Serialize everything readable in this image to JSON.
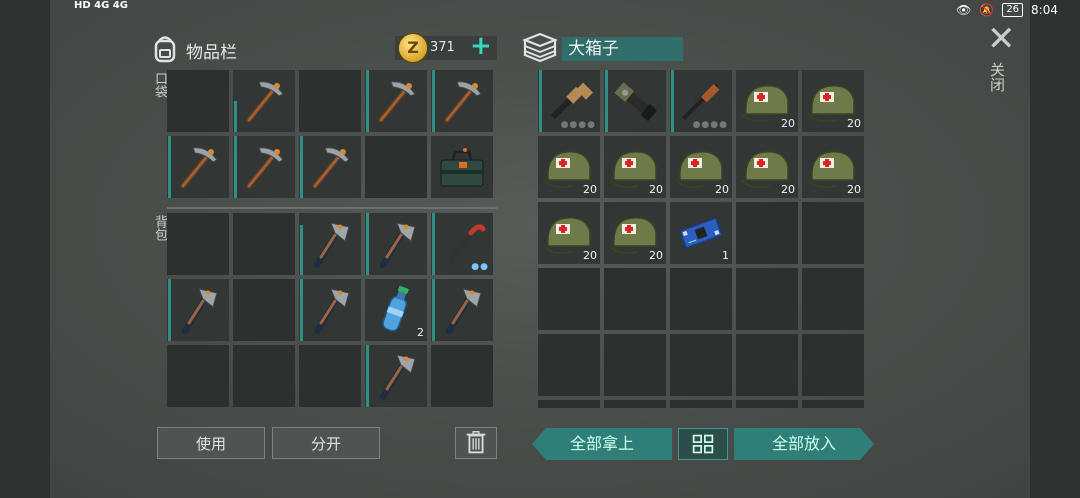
{
  "status": {
    "network_left": "HD 4G 4G",
    "battery": "26",
    "time": "8:04"
  },
  "inventory": {
    "title": "物品栏",
    "coins": "371",
    "pocket_label": "口袋",
    "backpack_label": "背包",
    "pocket_slots": [
      {
        "item": "",
        "bar": 0
      },
      {
        "item": "pickaxe",
        "bar": 0.5
      },
      {
        "item": "",
        "bar": 0
      },
      {
        "item": "pickaxe",
        "bar": 1
      },
      {
        "item": "pickaxe",
        "bar": 1
      },
      {
        "item": "pickaxe",
        "bar": 1
      },
      {
        "item": "pickaxe",
        "bar": 1
      },
      {
        "item": "pickaxe",
        "bar": 1
      },
      {
        "item": "",
        "bar": 0
      },
      {
        "item": "toolbox",
        "bar": 0
      }
    ],
    "backpack_slots": [
      {
        "item": "",
        "bar": 0
      },
      {
        "item": "",
        "bar": 0
      },
      {
        "item": "axe",
        "bar": 0.8
      },
      {
        "item": "axe",
        "bar": 1
      },
      {
        "item": "crowbar",
        "bar": 1,
        "dots": true
      },
      {
        "item": "axe",
        "bar": 1
      },
      {
        "item": "",
        "bar": 0
      },
      {
        "item": "axe",
        "bar": 1
      },
      {
        "item": "bottle",
        "bar": 0,
        "qty": "2"
      },
      {
        "item": "axe",
        "bar": 1
      },
      {
        "item": "",
        "bar": 0
      },
      {
        "item": "",
        "bar": 0
      },
      {
        "item": "",
        "bar": 0
      },
      {
        "item": "axe",
        "bar": 1
      },
      {
        "item": "",
        "bar": 0
      }
    ]
  },
  "chest": {
    "title": "大箱子",
    "slots": [
      {
        "item": "rifle",
        "bar": 1,
        "graydots": true
      },
      {
        "item": "minigun",
        "bar": 1
      },
      {
        "item": "sniper",
        "bar": 1,
        "graydots": true
      },
      {
        "item": "medbag",
        "qty": "20"
      },
      {
        "item": "medbag",
        "qty": "20"
      },
      {
        "item": "medbag",
        "qty": "20"
      },
      {
        "item": "medbag",
        "qty": "20"
      },
      {
        "item": "medbag",
        "qty": "20"
      },
      {
        "item": "medbag",
        "qty": "20"
      },
      {
        "item": "medbag",
        "qty": "20"
      },
      {
        "item": "medbag",
        "qty": "20"
      },
      {
        "item": "medbag",
        "qty": "20"
      },
      {
        "item": "circuit",
        "qty": "1"
      },
      {
        "item": ""
      },
      {
        "item": ""
      },
      {
        "item": ""
      },
      {
        "item": ""
      },
      {
        "item": ""
      },
      {
        "item": ""
      },
      {
        "item": ""
      },
      {
        "item": ""
      },
      {
        "item": ""
      },
      {
        "item": ""
      },
      {
        "item": ""
      },
      {
        "item": ""
      },
      {
        "item": ""
      },
      {
        "item": ""
      },
      {
        "item": ""
      },
      {
        "item": ""
      },
      {
        "item": ""
      }
    ]
  },
  "buttons": {
    "use": "使用",
    "split": "分开",
    "take_all": "全部拿上",
    "sort": "",
    "put_all": "全部放入",
    "close": "关闭"
  },
  "colors": {
    "accent": "#2f7f78",
    "bar": "#2e8f86",
    "plus": "#39d3c0"
  }
}
